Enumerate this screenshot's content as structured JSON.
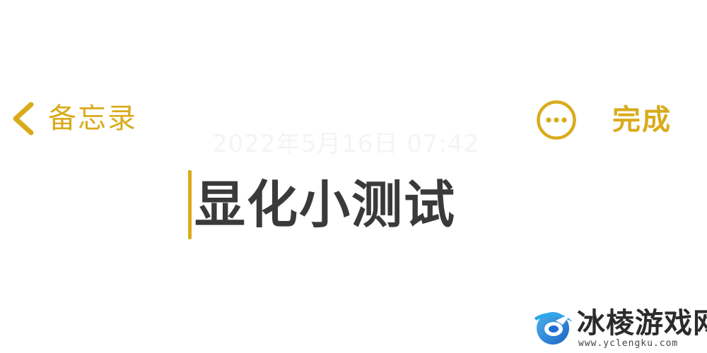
{
  "nav": {
    "back_label": "备忘录",
    "more_icon": "ellipsis-circle-icon",
    "back_icon": "chevron-left-icon",
    "done_label": "完成"
  },
  "note": {
    "date": "2022年5月16日 07:42",
    "title": "显化小测试"
  },
  "watermark": {
    "logo_icon": "game-site-logo-icon",
    "name": "冰棱游戏网",
    "url": "www.yclengku.com"
  },
  "colors": {
    "accent": "#d9ab1c",
    "title_text": "#3a3a3a",
    "date_text": "#f4f4f4",
    "background": "#ffffff"
  }
}
